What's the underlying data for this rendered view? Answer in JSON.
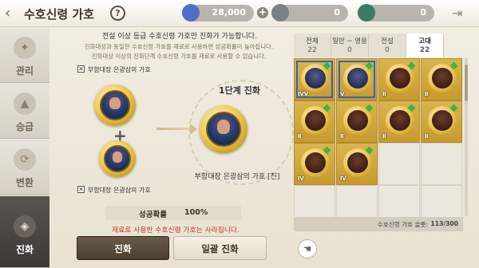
{
  "header": {
    "title": "수호신령 가호",
    "help_label": "?",
    "currency1": "28,000",
    "currency2": "0",
    "currency3": "0",
    "plus": "+"
  },
  "sidebar": {
    "items": [
      {
        "label": "관리",
        "icon": "wing-icon"
      },
      {
        "label": "승급",
        "icon": "upgrade-icon"
      },
      {
        "label": "변환",
        "icon": "convert-icon"
      },
      {
        "label": "진화",
        "icon": "evolve-icon",
        "active": true
      }
    ]
  },
  "evolve": {
    "headline": "전설 이상 등급 수호신령 가호만 진화가 가능합니다.",
    "desc1": "진화대상과 동일한 수호신령 가호를 재료로 사용하면 성공확률이 높아집니다.",
    "desc2": "진화대상 이상의 진화단계 수호신령 가호를 재료로 사용할 수 있습니다.",
    "target_label": "부함대장 은광삼의 가호",
    "material_label": "부함대장 은광삼의 가호",
    "check_mark": "✕",
    "stage_title": "1단계 진화",
    "result_name": "부함대장 은광삼의 가호 [진]",
    "rate_label": "성공확률",
    "rate_value": "100%",
    "warning": "재료로 사용한 수호신령 가호는 사라집니다.",
    "evolve_button": "진화",
    "bulk_button": "일괄 진화"
  },
  "filter_tabs": [
    {
      "label": "전체",
      "count": "22"
    },
    {
      "label": "일반 ~ 영웅",
      "count": "0"
    },
    {
      "label": "전설",
      "count": "0"
    },
    {
      "label": "고대",
      "count": "22",
      "active": true
    }
  ],
  "inventory": {
    "cells": [
      {
        "lvl": "ⅣV",
        "selected": true,
        "portrait": "blue"
      },
      {
        "lvl": "V",
        "selected": true,
        "portrait": "blue"
      },
      {
        "lvl": "Ⅱ",
        "selected": false,
        "portrait": "red"
      },
      {
        "lvl": "Ⅱ",
        "selected": false,
        "portrait": "red"
      },
      {
        "lvl": "Ⅱ",
        "selected": false,
        "portrait": "red"
      },
      {
        "lvl": "Ⅱ",
        "selected": false,
        "portrait": "red"
      },
      {
        "lvl": "Ⅱ",
        "selected": false,
        "portrait": "red"
      },
      {
        "lvl": "Ⅱ",
        "selected": false,
        "portrait": "red"
      },
      {
        "lvl": "Ⅳ",
        "selected": false,
        "portrait": "red"
      },
      {
        "lvl": "Ⅳ",
        "selected": false,
        "portrait": "red"
      }
    ],
    "slots_label": "수호신령 가호 슬롯:",
    "slots_value": "113/300"
  }
}
